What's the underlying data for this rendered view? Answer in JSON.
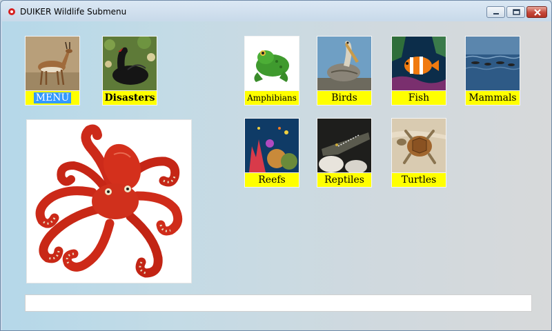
{
  "window": {
    "title": "DUIKER Wildlife Submenu"
  },
  "nav": {
    "menu": "MENU",
    "disasters": "Disasters"
  },
  "categories": {
    "amphibians": "Amphibians",
    "birds": "Birds",
    "fish": "Fish",
    "mammals": "Mammals",
    "reefs": "Reefs",
    "reptiles": "Reptiles",
    "turtles": "Turtles"
  },
  "status": {
    "text": ""
  },
  "colors": {
    "label_bg": "#ffff00",
    "selection": "#3399ff"
  }
}
